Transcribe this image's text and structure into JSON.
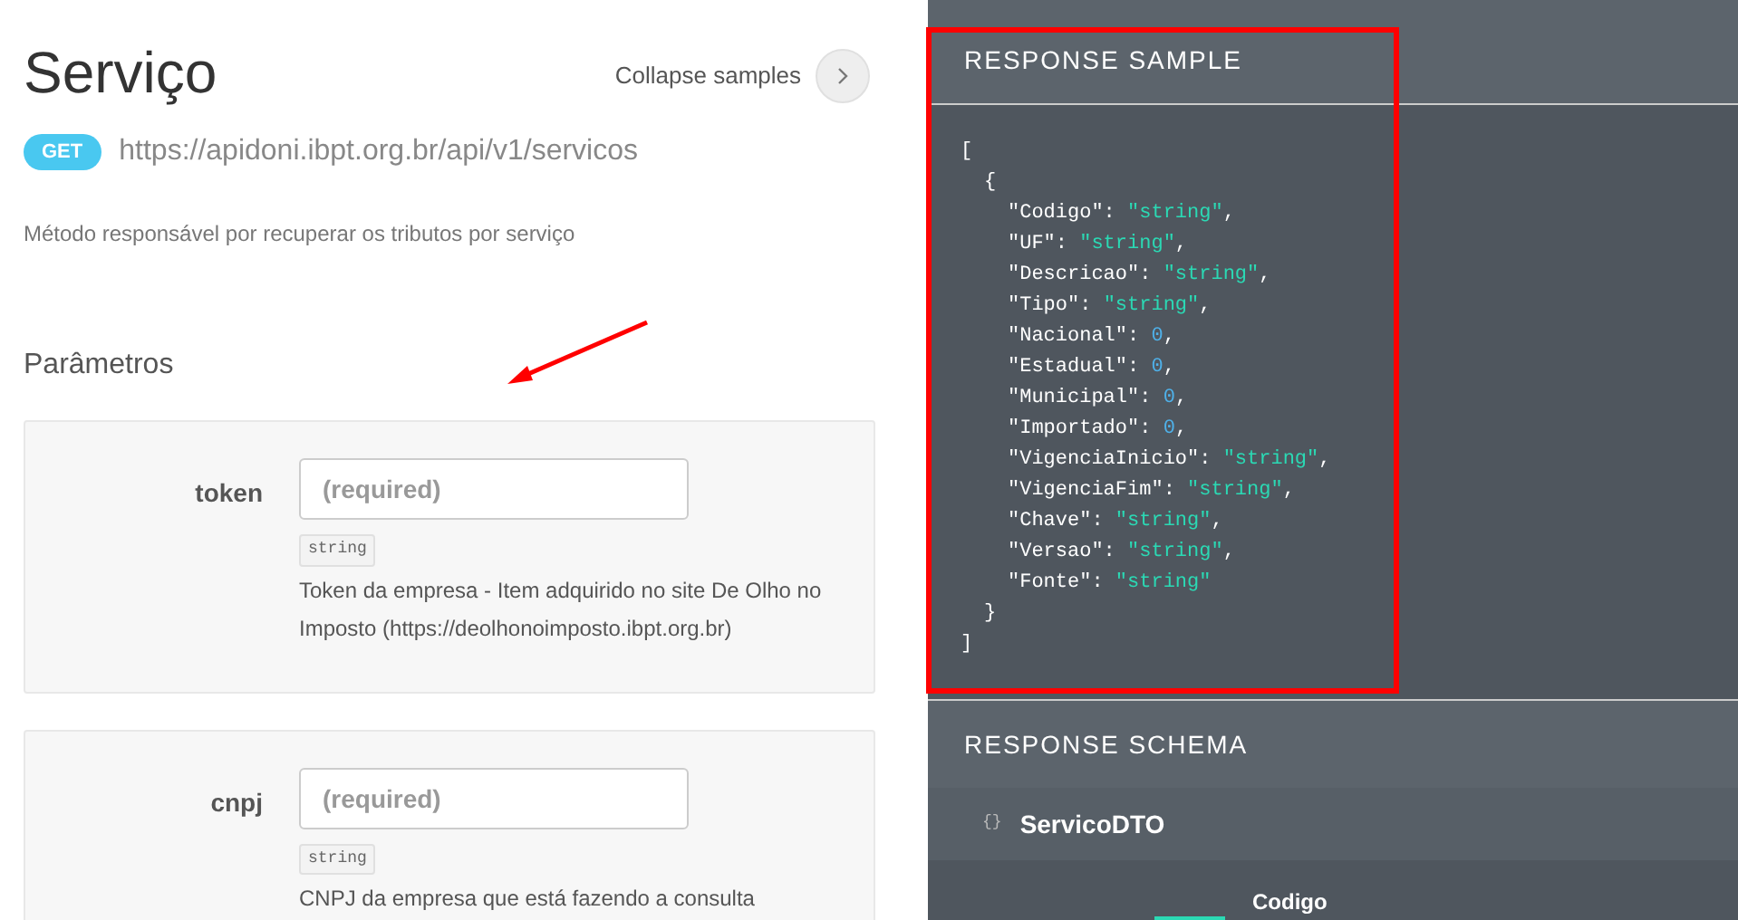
{
  "endpoint": {
    "title": "Serviço",
    "collapse_label": "Collapse samples",
    "method": "GET",
    "url": "https://apidoni.ibpt.org.br/api/v1/servicos",
    "description": "Método responsável por recuperar os tributos por serviço"
  },
  "parameters": {
    "heading": "Parâmetros",
    "items": [
      {
        "name": "token",
        "placeholder": "(required)",
        "type": "string",
        "description": "Token da empresa - Item adquirido no site De Olho no Imposto (https://deolhonoimposto.ibpt.org.br)"
      },
      {
        "name": "cnpj",
        "placeholder": "(required)",
        "type": "string",
        "description": "CNPJ da empresa que está fazendo a consulta"
      }
    ]
  },
  "response_sample": {
    "heading": "RESPONSE SAMPLE",
    "open": "[",
    "object_open": "{",
    "object_close": "}",
    "close": "]",
    "fields": [
      {
        "key": "\"Codigo\": ",
        "value": "\"string\"",
        "tail": ",",
        "kind": "string"
      },
      {
        "key": "\"UF\": ",
        "value": "\"string\"",
        "tail": ",",
        "kind": "string"
      },
      {
        "key": "\"Descricao\": ",
        "value": "\"string\"",
        "tail": ",",
        "kind": "string"
      },
      {
        "key": "\"Tipo\": ",
        "value": "\"string\"",
        "tail": ",",
        "kind": "string"
      },
      {
        "key": "\"Nacional\": ",
        "value": "0",
        "tail": ",",
        "kind": "number"
      },
      {
        "key": "\"Estadual\": ",
        "value": "0",
        "tail": ",",
        "kind": "number"
      },
      {
        "key": "\"Municipal\": ",
        "value": "0",
        "tail": ",",
        "kind": "number"
      },
      {
        "key": "\"Importado\": ",
        "value": "0",
        "tail": ",",
        "kind": "number"
      },
      {
        "key": "\"VigenciaInicio\": ",
        "value": "\"string\"",
        "tail": ",",
        "kind": "string"
      },
      {
        "key": "\"VigenciaFim\": ",
        "value": "\"string\"",
        "tail": ",",
        "kind": "string"
      },
      {
        "key": "\"Chave\": ",
        "value": "\"string\"",
        "tail": ",",
        "kind": "string"
      },
      {
        "key": "\"Versao\": ",
        "value": "\"string\"",
        "tail": ",",
        "kind": "string"
      },
      {
        "key": "\"Fonte\": ",
        "value": "\"string\"",
        "kind": "string"
      }
    ]
  },
  "response_schema": {
    "heading": "RESPONSE SCHEMA",
    "model_icon": "{}",
    "model": "ServicoDTO",
    "first_property": "Codigo"
  }
}
